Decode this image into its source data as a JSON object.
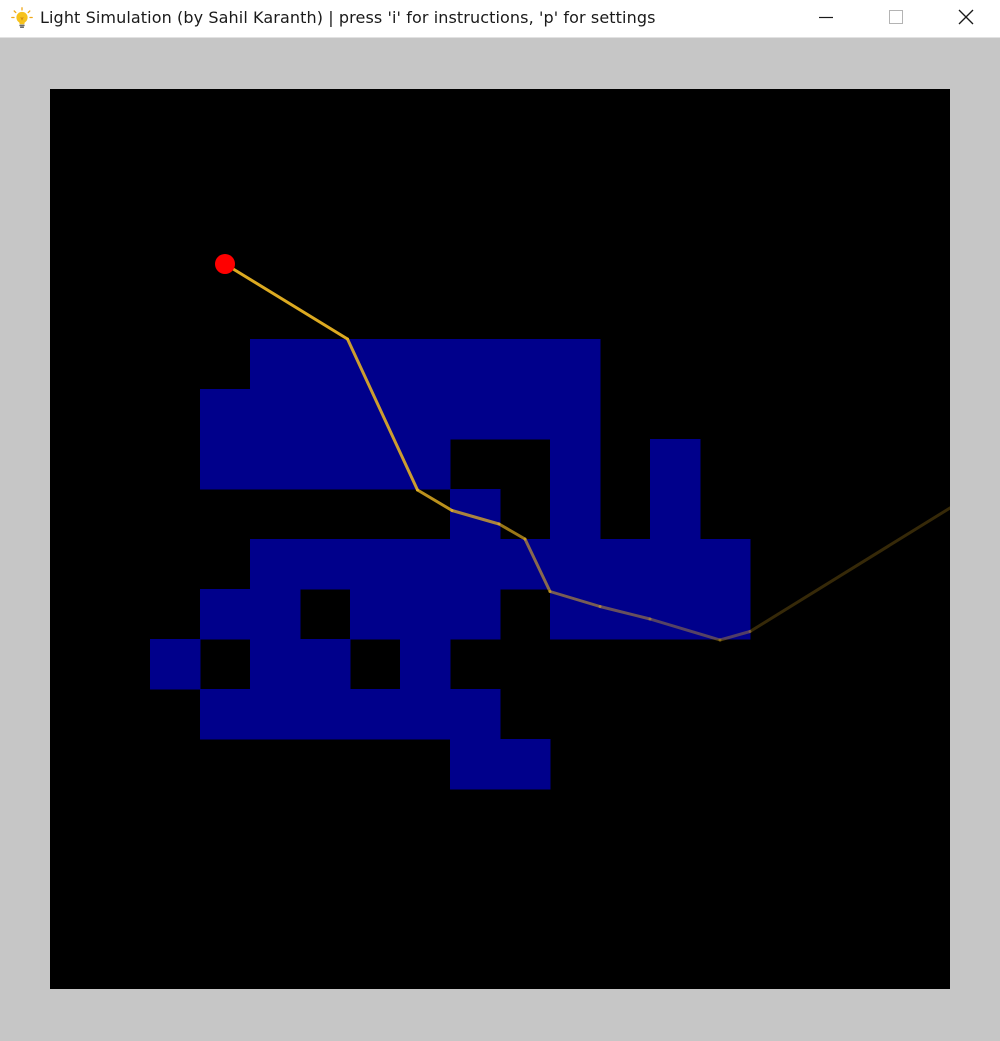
{
  "window": {
    "title": "Light Simulation (by Sahil Karanth) | press 'i' for instructions, 'p' for settings",
    "icon": "lightbulb-icon",
    "controls": {
      "minimize_icon": "minimize-icon",
      "maximize_icon": "maximize-icon",
      "close_icon": "close-icon"
    }
  },
  "simulation": {
    "background_color": "#000000",
    "medium_color": "#00008b",
    "source_color": "#ff0000",
    "ray_color": "#e8b323",
    "grid_size": 18,
    "medium_cells": [
      [
        4,
        5
      ],
      [
        5,
        5
      ],
      [
        6,
        5
      ],
      [
        7,
        5
      ],
      [
        8,
        5
      ],
      [
        9,
        5
      ],
      [
        10,
        5
      ],
      [
        3,
        6
      ],
      [
        4,
        6
      ],
      [
        5,
        6
      ],
      [
        6,
        6
      ],
      [
        7,
        6
      ],
      [
        8,
        6
      ],
      [
        9,
        6
      ],
      [
        10,
        6
      ],
      [
        3,
        7
      ],
      [
        4,
        7
      ],
      [
        5,
        7
      ],
      [
        6,
        7
      ],
      [
        7,
        7
      ],
      [
        10,
        7
      ],
      [
        12,
        7
      ],
      [
        8,
        8
      ],
      [
        10,
        8
      ],
      [
        12,
        8
      ],
      [
        4,
        9
      ],
      [
        5,
        9
      ],
      [
        6,
        9
      ],
      [
        7,
        9
      ],
      [
        8,
        9
      ],
      [
        9,
        9
      ],
      [
        10,
        9
      ],
      [
        11,
        9
      ],
      [
        12,
        9
      ],
      [
        13,
        9
      ],
      [
        3,
        10
      ],
      [
        4,
        10
      ],
      [
        6,
        10
      ],
      [
        7,
        10
      ],
      [
        8,
        10
      ],
      [
        10,
        10
      ],
      [
        11,
        10
      ],
      [
        12,
        10
      ],
      [
        13,
        10
      ],
      [
        2,
        11
      ],
      [
        4,
        11
      ],
      [
        5,
        11
      ],
      [
        7,
        11
      ],
      [
        3,
        12
      ],
      [
        4,
        12
      ],
      [
        5,
        12
      ],
      [
        6,
        12
      ],
      [
        7,
        12
      ],
      [
        8,
        12
      ],
      [
        8,
        13
      ],
      [
        9,
        13
      ]
    ],
    "light_source": {
      "x": 3.5,
      "y": 3.5
    },
    "ray_path": [
      [
        3.5,
        3.5
      ],
      [
        5.95,
        5.0
      ],
      [
        7.35,
        8.02
      ],
      [
        8.04,
        8.43
      ],
      [
        8.98,
        8.7
      ],
      [
        9.5,
        9.0
      ],
      [
        10.0,
        10.05
      ],
      [
        11.0,
        10.35
      ],
      [
        12.0,
        10.6
      ],
      [
        13.4,
        11.02
      ],
      [
        14.0,
        10.85
      ],
      [
        18.0,
        8.38
      ]
    ]
  }
}
